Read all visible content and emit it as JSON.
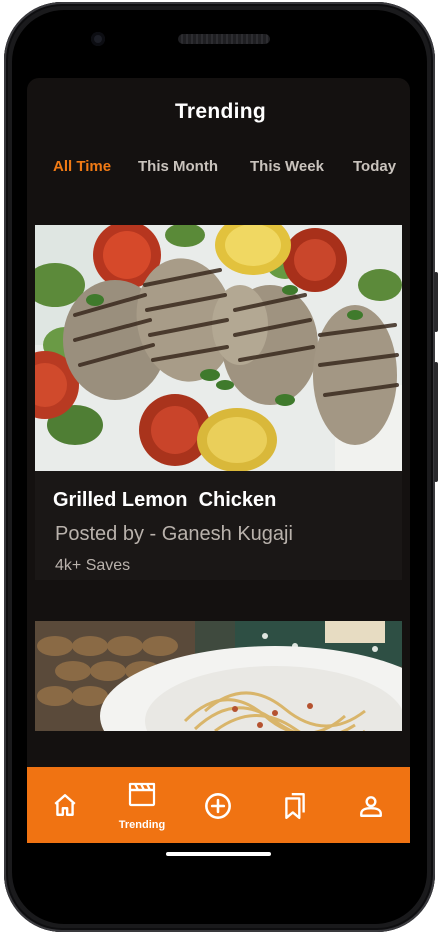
{
  "header": {
    "title": "Trending"
  },
  "tabs": [
    {
      "label": "All Time",
      "active": true
    },
    {
      "label": "This Month",
      "active": false
    },
    {
      "label": "This Week",
      "active": false
    },
    {
      "label": "Today",
      "active": false
    }
  ],
  "feed": {
    "cards": [
      {
        "title": "Grilled Lemon  Chicken",
        "author": "Posted by - Ganesh Kugaji",
        "saves": "4k+ Saves",
        "image_subject": "grilled lemon chicken with tomatoes and herbs"
      },
      {
        "image_subject": "spaghetti pasta on a white plate"
      }
    ]
  },
  "bottom_nav": {
    "items": [
      {
        "icon": "home-icon",
        "label": ""
      },
      {
        "icon": "clapperboard-icon",
        "label": "Trending",
        "active": true
      },
      {
        "icon": "add-circle-icon",
        "label": ""
      },
      {
        "icon": "bookmarks-icon",
        "label": ""
      },
      {
        "icon": "person-icon",
        "label": ""
      }
    ]
  },
  "colors": {
    "accent": "#f07312",
    "tab_active": "#f07a15",
    "background": "#141110",
    "text_primary": "#ffffff",
    "text_secondary": "#b9b2ac"
  }
}
